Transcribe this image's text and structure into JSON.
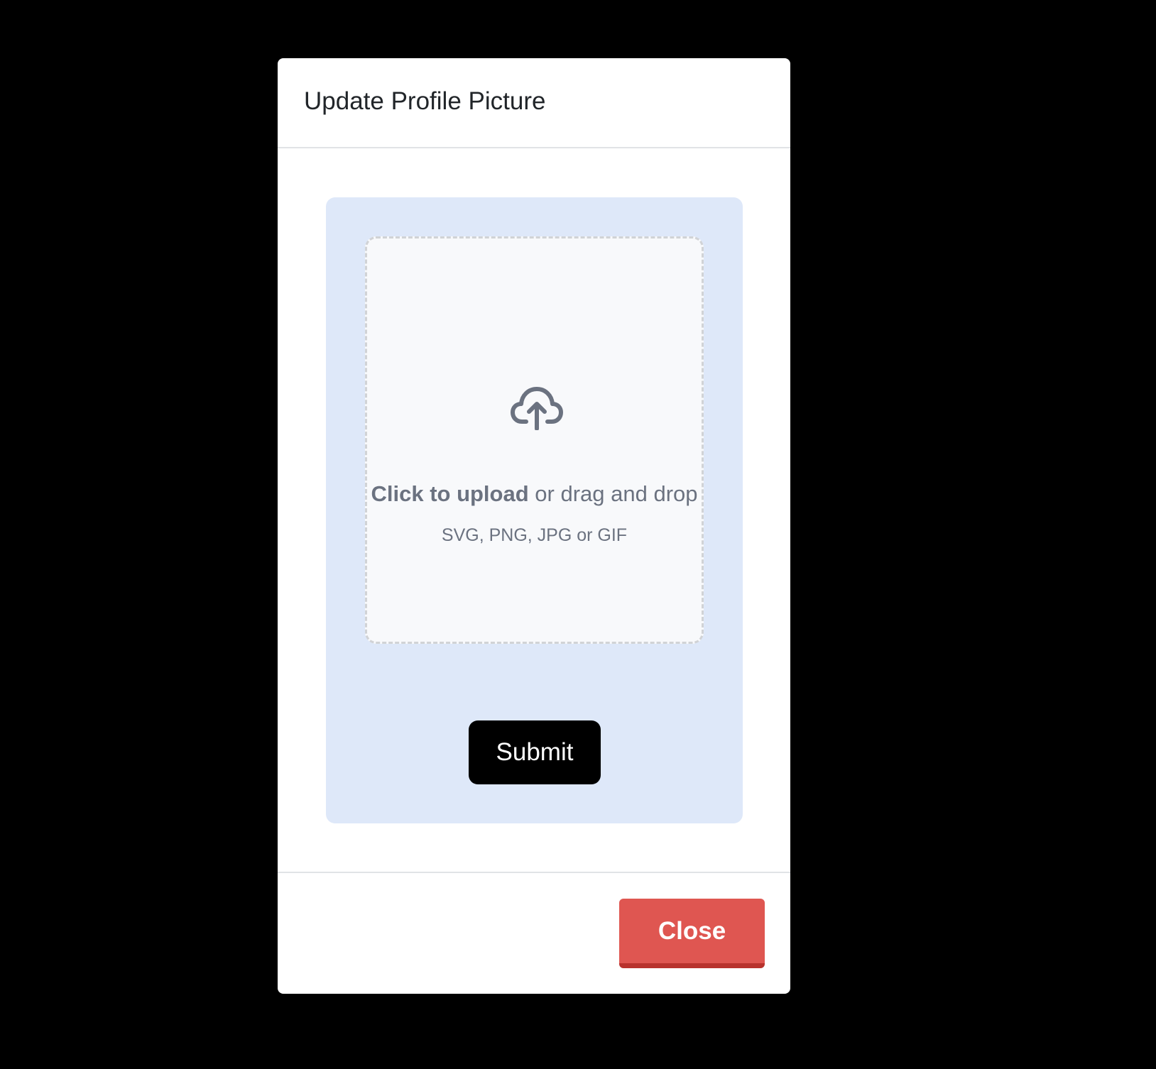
{
  "modal": {
    "title": "Update Profile Picture"
  },
  "upload": {
    "icon": "cloud-upload-icon",
    "click_label": "Click to upload",
    "drag_label": " or drag and drop",
    "formats": "SVG, PNG, JPG or GIF",
    "submit_label": "Submit"
  },
  "footer": {
    "close_label": "Close"
  },
  "colors": {
    "backdrop": "#000000",
    "panel": "#dee8f9",
    "dropzone": "#f8f9fb",
    "submit": "#000000",
    "close": "#df5651",
    "muted_text": "#6b7280"
  }
}
